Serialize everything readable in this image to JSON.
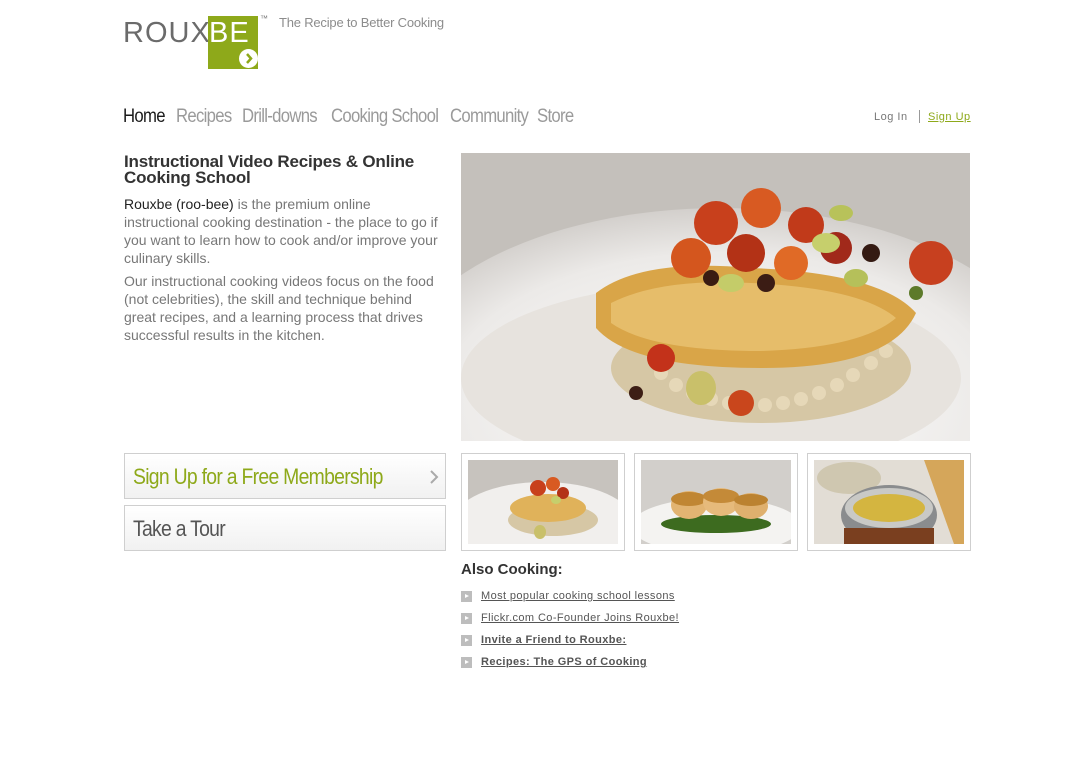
{
  "brand": {
    "logo_left": "ROUX",
    "logo_right": "BE",
    "trademark": "™",
    "tagline": "The Recipe to Better Cooking"
  },
  "nav": {
    "items": [
      {
        "label": "Home",
        "active": true
      },
      {
        "label": "Recipes",
        "active": false
      },
      {
        "label": "Drill-downs",
        "active": false
      },
      {
        "label": "Cooking School",
        "active": false
      },
      {
        "label": "Community",
        "active": false
      },
      {
        "label": "Store",
        "active": false
      }
    ],
    "login": "Log In",
    "signup": "Sign Up"
  },
  "intro": {
    "title": "Instructional Video Recipes & Online Cooking School",
    "brand_name": "Rouxbe (roo-bee)",
    "p1_rest": " is the premium online instructional cooking destination - the place to go if you want to learn how to cook and/or improve your culinary skills.",
    "p2": "Our instructional cooking videos focus on the food (not celebrities), the skill and technique behind great recipes, and a learning process that drives successful results in the kitchen."
  },
  "cta": {
    "signup": "Sign Up for a Free Membership",
    "tour": "Take a Tour"
  },
  "also_cooking": {
    "title": "Also Cooking:",
    "items": [
      {
        "label": "Most popular cooking school lessons"
      },
      {
        "label": "Flickr.com Co-Founder Joins Rouxbe!"
      },
      {
        "label": "Invite a Friend to Rouxbe:"
      },
      {
        "label": "Recipes: The GPS of Cooking"
      }
    ]
  },
  "colors": {
    "accent": "#8ea91a",
    "text": "#333333",
    "muted": "#777777"
  }
}
